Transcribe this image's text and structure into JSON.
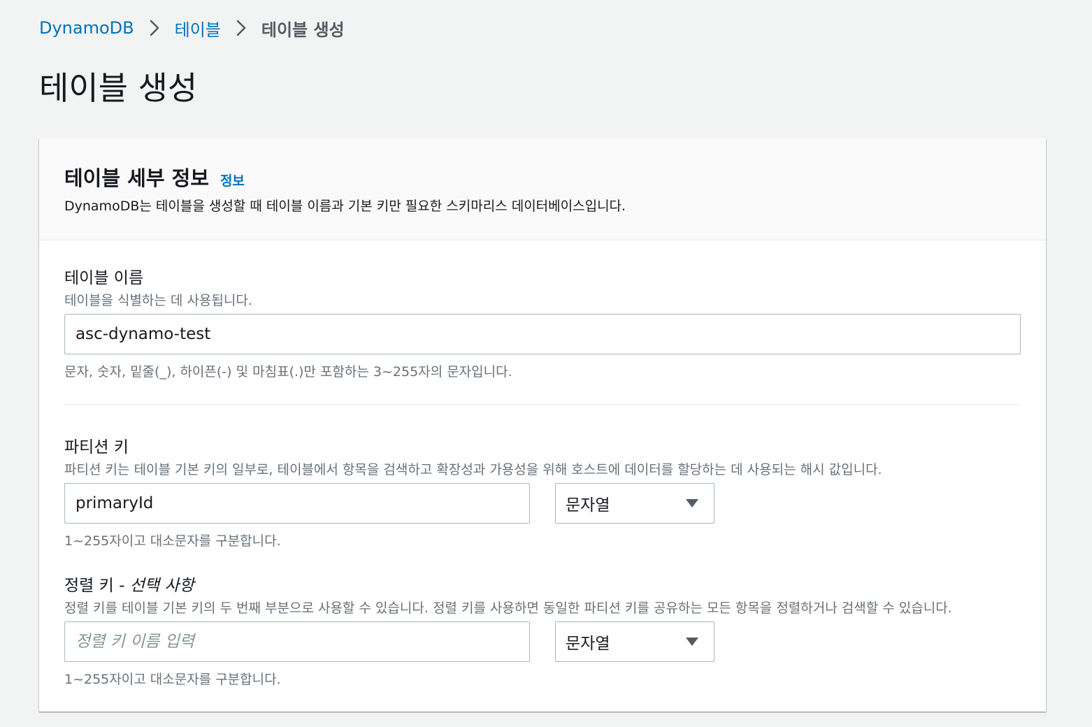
{
  "breadcrumb": {
    "items": [
      "DynamoDB",
      "테이블",
      "테이블 생성"
    ]
  },
  "page_title": "테이블 생성",
  "panel": {
    "title": "테이블 세부 정보",
    "info_link": "정보",
    "description": "DynamoDB는 테이블을 생성할 때 테이블 이름과 기본 키만 필요한 스키마리스 데이터베이스입니다."
  },
  "table_name": {
    "label": "테이블 이름",
    "description": "테이블을 식별하는 데 사용됩니다.",
    "value": "asc-dynamo-test",
    "constraint": "문자, 숫자, 밑줄(_), 하이픈(-) 및 마침표(.)만 포함하는 3~255자의 문자입니다."
  },
  "partition_key": {
    "label": "파티션 키",
    "description": "파티션 키는 테이블 기본 키의 일부로, 테이블에서 항목을 검색하고 확장성과 가용성을 위해 호스트에 데이터를 할당하는 데 사용되는 해시 값입니다.",
    "value": "primaryId",
    "type": "문자열",
    "constraint": "1~255자이고 대소문자를 구분합니다."
  },
  "sort_key": {
    "label": "정렬 키",
    "label_suffix": " - ",
    "optional": "선택 사항",
    "description": "정렬 키를 테이블 기본 키의 두 번째 부분으로 사용할 수 있습니다. 정렬 키를 사용하면 동일한 파티션 키를 공유하는 모든 항목을 정렬하거나 검색할 수 있습니다.",
    "placeholder": "정렬 키 이름 입력",
    "type": "문자열",
    "constraint": "1~255자이고 대소문자를 구분합니다."
  },
  "colors": {
    "link": "#0073bb",
    "background": "#f2f3f3",
    "border": "#aab7b8"
  },
  "icons": {
    "breadcrumb_separator": "chevron-right-icon",
    "select_caret": "caret-down-icon"
  }
}
